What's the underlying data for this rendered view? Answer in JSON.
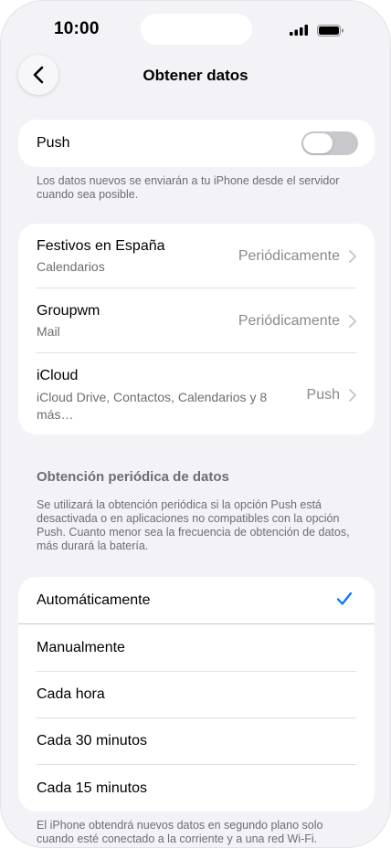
{
  "status_bar": {
    "time": "10:00"
  },
  "nav": {
    "title": "Obtener datos"
  },
  "push": {
    "label": "Push",
    "enabled": false,
    "footnote": "Los datos nuevos se enviarán a tu iPhone desde el servidor cuando sea posible."
  },
  "accounts": [
    {
      "title": "Festivos en España",
      "subtitle": "Calendarios",
      "value": "Periódicamente"
    },
    {
      "title": "Groupwm",
      "subtitle": "Mail",
      "value": "Periódicamente"
    },
    {
      "title": "iCloud",
      "subtitle": "iCloud Drive, Contactos, Calendarios y 8 más…",
      "value": "Push"
    }
  ],
  "fetch": {
    "header": "Obtención periódica de datos",
    "description": "Se utilizará la obtención periódica si la opción Push está desactivada o en aplicaciones no compatibles con la opción Push. Cuanto menor sea la frecuencia de obtención de datos, más durará la batería.",
    "options": [
      {
        "label": "Automáticamente",
        "selected": true
      },
      {
        "label": "Manualmente",
        "selected": false
      },
      {
        "label": "Cada hora",
        "selected": false
      },
      {
        "label": "Cada 30 minutos",
        "selected": false
      },
      {
        "label": "Cada 15 minutos",
        "selected": false
      }
    ],
    "footnote": "El iPhone obtendrá nuevos datos en segundo plano solo cuando esté conectado a la corriente y a una red Wi-Fi."
  },
  "colors": {
    "accent": "#007aff",
    "toggle_off": "#c7c7cc",
    "background": "#f2f2f7"
  },
  "icons": [
    "back-chevron-icon",
    "cellular-signal-icon",
    "battery-icon",
    "chevron-right-icon",
    "checkmark-icon"
  ]
}
